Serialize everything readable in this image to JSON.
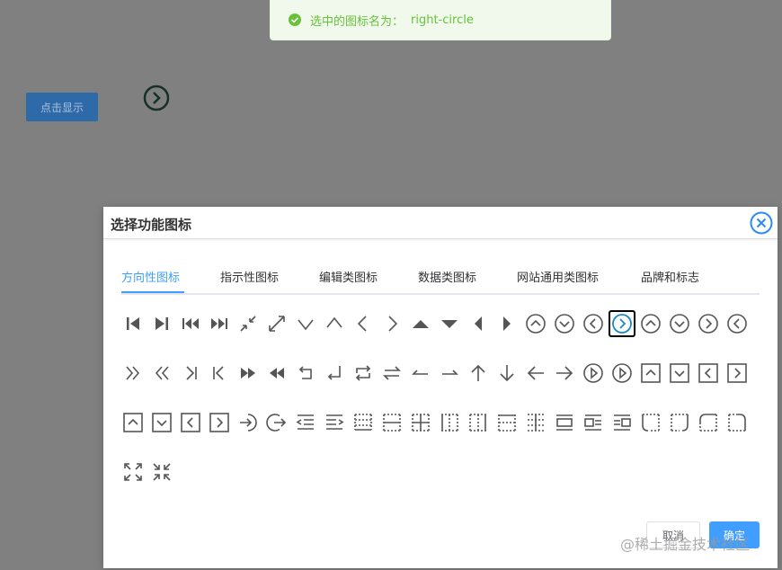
{
  "toast": {
    "text": "选中的图标名为：",
    "icon_name": "right-circle",
    "color": "#67c23a"
  },
  "page": {
    "show_button_label": "点击显示",
    "preview_icon": "right-circle-icon"
  },
  "dialog": {
    "title": "选择功能图标",
    "tabs": [
      "方向性图标",
      "指示性图标",
      "编辑类图标",
      "数据类图标",
      "网站通用类图标",
      "品牌和标志"
    ],
    "active_tab": 0,
    "selected_icon_index": 17,
    "cancel_label": "取消",
    "ok_label": "确定",
    "icons": [
      "step-backward",
      "step-forward",
      "fast-backward",
      "fast-forward",
      "shrink",
      "arrows-alt",
      "down",
      "up",
      "left",
      "right",
      "caret-up",
      "caret-down",
      "caret-left",
      "caret-right",
      "up-circle",
      "down-circle",
      "left-circle",
      "right-circle",
      "up-circle-o",
      "down-circle-o",
      "right-circle-o",
      "left-circle-o",
      "double-right",
      "double-left",
      "vertical-left",
      "vertical-right",
      "forward",
      "backward",
      "rollback",
      "enter",
      "retweet",
      "swap",
      "swap-left",
      "swap-right",
      "arrow-up",
      "arrow-down",
      "arrow-left",
      "arrow-right",
      "play-circle",
      "play-circle-o",
      "up-square",
      "down-square",
      "left-square",
      "right-square",
      "up-square-o",
      "down-square-o",
      "left-square-o",
      "right-square-o",
      "login",
      "logout",
      "menu-fold",
      "menu-unfold",
      "border-bottom",
      "border-horizontal",
      "border-inner",
      "border-left",
      "border-right",
      "border-top",
      "border-verticle",
      "pic-center",
      "pic-left",
      "pic-right",
      "radius-bottomleft",
      "radius-bottomright",
      "radius-upleft",
      "radius-upright",
      "fullscreen",
      "fullscreen-exit"
    ]
  },
  "watermark": "@稀土掘金技术社区"
}
